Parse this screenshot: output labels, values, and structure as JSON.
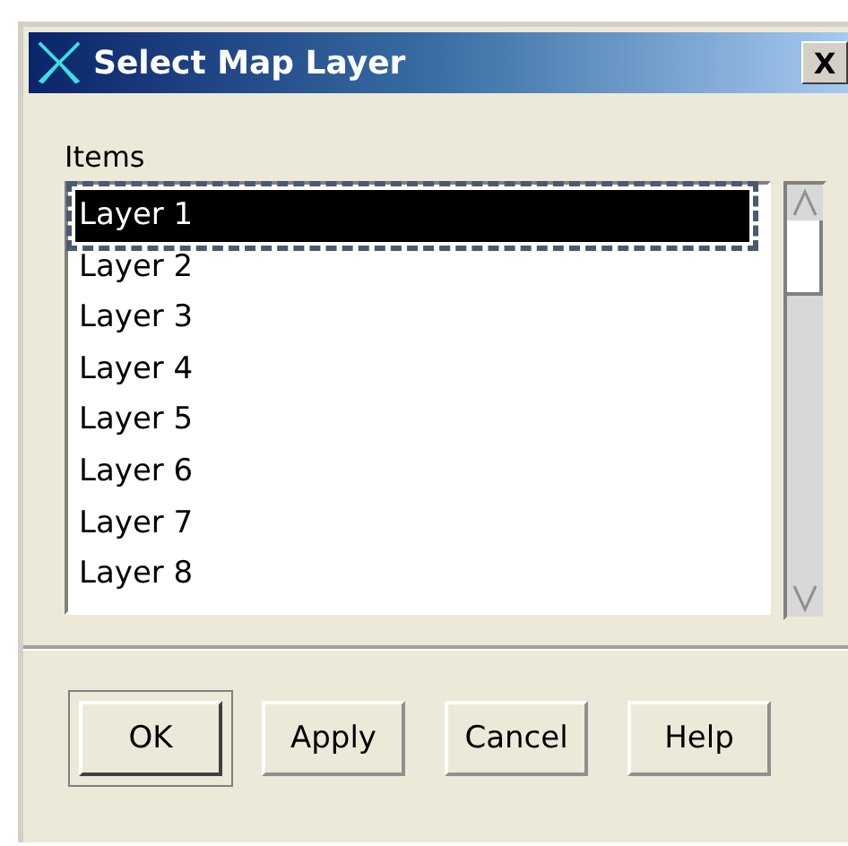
{
  "window": {
    "title": "Select Map Layer",
    "close": "X"
  },
  "list": {
    "label": "Items",
    "items": [
      {
        "label": "Layer 1",
        "selected": true
      },
      {
        "label": "Layer 2",
        "selected": false
      },
      {
        "label": "Layer 3",
        "selected": false
      },
      {
        "label": "Layer 4",
        "selected": false
      },
      {
        "label": "Layer 5",
        "selected": false
      },
      {
        "label": "Layer 6",
        "selected": false
      },
      {
        "label": "Layer 7",
        "selected": false
      },
      {
        "label": "Layer 8",
        "selected": false
      }
    ]
  },
  "buttons": [
    {
      "label": "OK",
      "default": true
    },
    {
      "label": "Apply",
      "default": false
    },
    {
      "label": "Cancel",
      "default": false
    },
    {
      "label": "Help",
      "default": false
    }
  ]
}
